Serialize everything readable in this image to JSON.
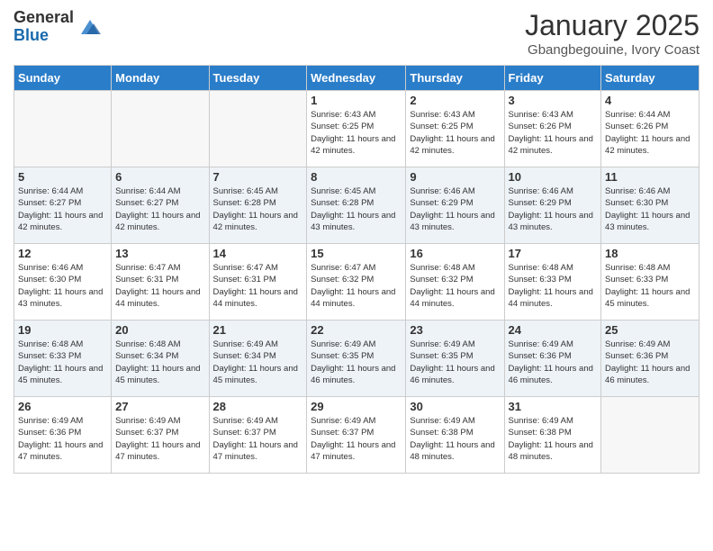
{
  "header": {
    "logo_general": "General",
    "logo_blue": "Blue",
    "title": "January 2025",
    "location": "Gbangbegouine, Ivory Coast"
  },
  "days_of_week": [
    "Sunday",
    "Monday",
    "Tuesday",
    "Wednesday",
    "Thursday",
    "Friday",
    "Saturday"
  ],
  "weeks": [
    [
      {
        "day": "",
        "sunrise": "",
        "sunset": "",
        "daylight": "",
        "empty": true
      },
      {
        "day": "",
        "sunrise": "",
        "sunset": "",
        "daylight": "",
        "empty": true
      },
      {
        "day": "",
        "sunrise": "",
        "sunset": "",
        "daylight": "",
        "empty": true
      },
      {
        "day": "1",
        "sunrise": "Sunrise: 6:43 AM",
        "sunset": "Sunset: 6:25 PM",
        "daylight": "Daylight: 11 hours and 42 minutes.",
        "empty": false
      },
      {
        "day": "2",
        "sunrise": "Sunrise: 6:43 AM",
        "sunset": "Sunset: 6:25 PM",
        "daylight": "Daylight: 11 hours and 42 minutes.",
        "empty": false
      },
      {
        "day": "3",
        "sunrise": "Sunrise: 6:43 AM",
        "sunset": "Sunset: 6:26 PM",
        "daylight": "Daylight: 11 hours and 42 minutes.",
        "empty": false
      },
      {
        "day": "4",
        "sunrise": "Sunrise: 6:44 AM",
        "sunset": "Sunset: 6:26 PM",
        "daylight": "Daylight: 11 hours and 42 minutes.",
        "empty": false
      }
    ],
    [
      {
        "day": "5",
        "sunrise": "Sunrise: 6:44 AM",
        "sunset": "Sunset: 6:27 PM",
        "daylight": "Daylight: 11 hours and 42 minutes.",
        "empty": false
      },
      {
        "day": "6",
        "sunrise": "Sunrise: 6:44 AM",
        "sunset": "Sunset: 6:27 PM",
        "daylight": "Daylight: 11 hours and 42 minutes.",
        "empty": false
      },
      {
        "day": "7",
        "sunrise": "Sunrise: 6:45 AM",
        "sunset": "Sunset: 6:28 PM",
        "daylight": "Daylight: 11 hours and 42 minutes.",
        "empty": false
      },
      {
        "day": "8",
        "sunrise": "Sunrise: 6:45 AM",
        "sunset": "Sunset: 6:28 PM",
        "daylight": "Daylight: 11 hours and 43 minutes.",
        "empty": false
      },
      {
        "day": "9",
        "sunrise": "Sunrise: 6:46 AM",
        "sunset": "Sunset: 6:29 PM",
        "daylight": "Daylight: 11 hours and 43 minutes.",
        "empty": false
      },
      {
        "day": "10",
        "sunrise": "Sunrise: 6:46 AM",
        "sunset": "Sunset: 6:29 PM",
        "daylight": "Daylight: 11 hours and 43 minutes.",
        "empty": false
      },
      {
        "day": "11",
        "sunrise": "Sunrise: 6:46 AM",
        "sunset": "Sunset: 6:30 PM",
        "daylight": "Daylight: 11 hours and 43 minutes.",
        "empty": false
      }
    ],
    [
      {
        "day": "12",
        "sunrise": "Sunrise: 6:46 AM",
        "sunset": "Sunset: 6:30 PM",
        "daylight": "Daylight: 11 hours and 43 minutes.",
        "empty": false
      },
      {
        "day": "13",
        "sunrise": "Sunrise: 6:47 AM",
        "sunset": "Sunset: 6:31 PM",
        "daylight": "Daylight: 11 hours and 44 minutes.",
        "empty": false
      },
      {
        "day": "14",
        "sunrise": "Sunrise: 6:47 AM",
        "sunset": "Sunset: 6:31 PM",
        "daylight": "Daylight: 11 hours and 44 minutes.",
        "empty": false
      },
      {
        "day": "15",
        "sunrise": "Sunrise: 6:47 AM",
        "sunset": "Sunset: 6:32 PM",
        "daylight": "Daylight: 11 hours and 44 minutes.",
        "empty": false
      },
      {
        "day": "16",
        "sunrise": "Sunrise: 6:48 AM",
        "sunset": "Sunset: 6:32 PM",
        "daylight": "Daylight: 11 hours and 44 minutes.",
        "empty": false
      },
      {
        "day": "17",
        "sunrise": "Sunrise: 6:48 AM",
        "sunset": "Sunset: 6:33 PM",
        "daylight": "Daylight: 11 hours and 44 minutes.",
        "empty": false
      },
      {
        "day": "18",
        "sunrise": "Sunrise: 6:48 AM",
        "sunset": "Sunset: 6:33 PM",
        "daylight": "Daylight: 11 hours and 45 minutes.",
        "empty": false
      }
    ],
    [
      {
        "day": "19",
        "sunrise": "Sunrise: 6:48 AM",
        "sunset": "Sunset: 6:33 PM",
        "daylight": "Daylight: 11 hours and 45 minutes.",
        "empty": false
      },
      {
        "day": "20",
        "sunrise": "Sunrise: 6:48 AM",
        "sunset": "Sunset: 6:34 PM",
        "daylight": "Daylight: 11 hours and 45 minutes.",
        "empty": false
      },
      {
        "day": "21",
        "sunrise": "Sunrise: 6:49 AM",
        "sunset": "Sunset: 6:34 PM",
        "daylight": "Daylight: 11 hours and 45 minutes.",
        "empty": false
      },
      {
        "day": "22",
        "sunrise": "Sunrise: 6:49 AM",
        "sunset": "Sunset: 6:35 PM",
        "daylight": "Daylight: 11 hours and 46 minutes.",
        "empty": false
      },
      {
        "day": "23",
        "sunrise": "Sunrise: 6:49 AM",
        "sunset": "Sunset: 6:35 PM",
        "daylight": "Daylight: 11 hours and 46 minutes.",
        "empty": false
      },
      {
        "day": "24",
        "sunrise": "Sunrise: 6:49 AM",
        "sunset": "Sunset: 6:36 PM",
        "daylight": "Daylight: 11 hours and 46 minutes.",
        "empty": false
      },
      {
        "day": "25",
        "sunrise": "Sunrise: 6:49 AM",
        "sunset": "Sunset: 6:36 PM",
        "daylight": "Daylight: 11 hours and 46 minutes.",
        "empty": false
      }
    ],
    [
      {
        "day": "26",
        "sunrise": "Sunrise: 6:49 AM",
        "sunset": "Sunset: 6:36 PM",
        "daylight": "Daylight: 11 hours and 47 minutes.",
        "empty": false
      },
      {
        "day": "27",
        "sunrise": "Sunrise: 6:49 AM",
        "sunset": "Sunset: 6:37 PM",
        "daylight": "Daylight: 11 hours and 47 minutes.",
        "empty": false
      },
      {
        "day": "28",
        "sunrise": "Sunrise: 6:49 AM",
        "sunset": "Sunset: 6:37 PM",
        "daylight": "Daylight: 11 hours and 47 minutes.",
        "empty": false
      },
      {
        "day": "29",
        "sunrise": "Sunrise: 6:49 AM",
        "sunset": "Sunset: 6:37 PM",
        "daylight": "Daylight: 11 hours and 47 minutes.",
        "empty": false
      },
      {
        "day": "30",
        "sunrise": "Sunrise: 6:49 AM",
        "sunset": "Sunset: 6:38 PM",
        "daylight": "Daylight: 11 hours and 48 minutes.",
        "empty": false
      },
      {
        "day": "31",
        "sunrise": "Sunrise: 6:49 AM",
        "sunset": "Sunset: 6:38 PM",
        "daylight": "Daylight: 11 hours and 48 minutes.",
        "empty": false
      },
      {
        "day": "",
        "sunrise": "",
        "sunset": "",
        "daylight": "",
        "empty": true
      }
    ]
  ]
}
